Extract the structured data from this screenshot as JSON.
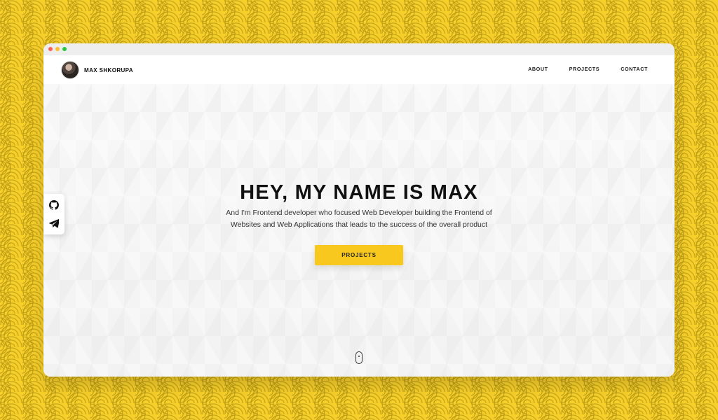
{
  "header": {
    "brand_name": "MAX SHKORUPA",
    "nav": [
      "ABOUT",
      "PROJECTS",
      "CONTACT"
    ]
  },
  "hero": {
    "title": "HEY, MY NAME IS MAX",
    "copy_line_1": "And I'm Frontend developer who focused Web Developer building the Frontend of",
    "copy_line_2": "Websites and Web Applications that leads to the success of the overall product",
    "button": "PROJECTS"
  },
  "social": {
    "items": [
      "github-icon",
      "telegram-icon"
    ]
  },
  "colors": {
    "page_background": "#f6cf2a",
    "button": "#f8c81e",
    "text_primary": "#111111"
  }
}
